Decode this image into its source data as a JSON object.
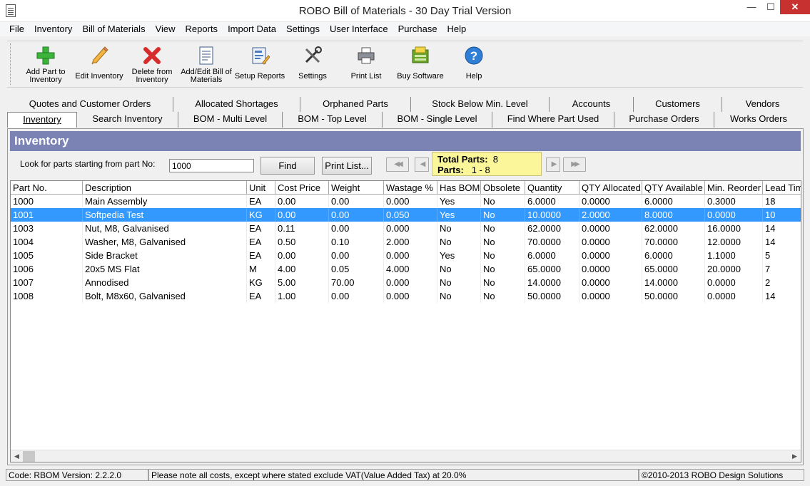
{
  "window": {
    "title": "ROBO Bill of Materials - 30 Day Trial Version"
  },
  "menu": [
    "File",
    "Inventory",
    "Bill of Materials",
    "View",
    "Reports",
    "Import Data",
    "Settings",
    "User Interface",
    "Purchase",
    "Help"
  ],
  "toolbar": {
    "add_part": "Add Part to Inventory",
    "edit_inventory": "Edit Inventory",
    "delete": "Delete from Inventory",
    "add_edit_bill": "Add/Edit Bill of Materials",
    "setup_reports": "Setup Reports",
    "settings": "Settings",
    "print_list": "Print List",
    "buy_software": "Buy Software",
    "help": "Help"
  },
  "tabs_row1": [
    "Quotes and Customer Orders",
    "Allocated Shortages",
    "Orphaned Parts",
    "Stock Below Min. Level",
    "Accounts",
    "Customers",
    "Vendors"
  ],
  "tabs_row2": [
    "Inventory",
    "Search Inventory",
    "BOM - Multi Level",
    "BOM - Top Level",
    "BOM - Single Level",
    "Find Where Part Used",
    "Purchase Orders",
    "Works Orders"
  ],
  "panel": {
    "title": "Inventory",
    "search_label": "Look for parts starting from part No:",
    "search_value": "1000",
    "find_button": "Find",
    "print_list_button": "Print List...",
    "total_parts_label": "Total Parts:",
    "total_parts_value": "8",
    "parts_label": "Parts:",
    "parts_range": "1 - 8"
  },
  "grid": {
    "columns": [
      "Part No.",
      "Description",
      "Unit",
      "Cost Price",
      "Weight",
      "Wastage %",
      "Has BOM",
      "Obsolete",
      "Quantity",
      "QTY Allocated",
      "QTY Available",
      "Min. Reorder",
      "Lead Time"
    ],
    "rows": [
      [
        "1000",
        "Main Assembly",
        "EA",
        "0.00",
        "0.00",
        "0.000",
        "Yes",
        "No",
        "6.0000",
        "0.0000",
        "6.0000",
        "0.3000",
        "18"
      ],
      [
        "1001",
        "Softpedia Test",
        "KG",
        "0.00",
        "0.00",
        "0.050",
        "Yes",
        "No",
        "10.0000",
        "2.0000",
        "8.0000",
        "0.0000",
        "10"
      ],
      [
        "1003",
        "Nut, M8, Galvanised",
        "EA",
        "0.11",
        "0.00",
        "0.000",
        "No",
        "No",
        "62.0000",
        "0.0000",
        "62.0000",
        "16.0000",
        "14"
      ],
      [
        "1004",
        "Washer, M8, Galvanised",
        "EA",
        "0.50",
        "0.10",
        "2.000",
        "No",
        "No",
        "70.0000",
        "0.0000",
        "70.0000",
        "12.0000",
        "14"
      ],
      [
        "1005",
        "Side Bracket",
        "EA",
        "0.00",
        "0.00",
        "0.000",
        "Yes",
        "No",
        "6.0000",
        "0.0000",
        "6.0000",
        "1.1000",
        "5"
      ],
      [
        "1006",
        "20x5 MS Flat",
        "M",
        "4.00",
        "0.05",
        "4.000",
        "No",
        "No",
        "65.0000",
        "0.0000",
        "65.0000",
        "20.0000",
        "7"
      ],
      [
        "1007",
        "Annodised",
        "KG",
        "5.00",
        "70.00",
        "0.000",
        "No",
        "No",
        "14.0000",
        "0.0000",
        "14.0000",
        "0.0000",
        "2"
      ],
      [
        "1008",
        "Bolt, M8x60, Galvanised",
        "EA",
        "1.00",
        "0.00",
        "0.000",
        "No",
        "No",
        "50.0000",
        "0.0000",
        "50.0000",
        "0.0000",
        "14"
      ]
    ],
    "selected_row": 1
  },
  "status": {
    "version": "Code: RBOM Version: 2.2.2.0",
    "note": "Please note all costs, except where stated exclude VAT(Value Added Tax) at 20.0%",
    "copyright": "©2010-2013 ROBO Design Solutions"
  }
}
